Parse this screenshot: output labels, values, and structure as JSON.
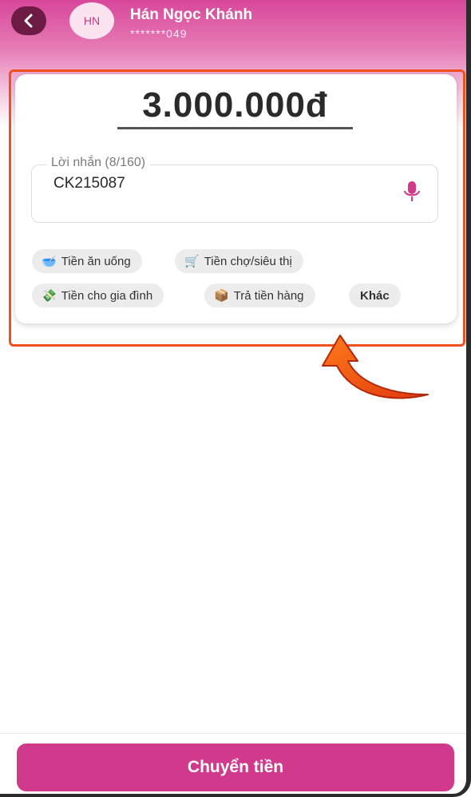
{
  "header": {
    "avatar_initials": "HN",
    "user_name": "Hán Ngọc Khánh",
    "user_phone": "*******049"
  },
  "amount": "3.000.000đ",
  "message": {
    "label": "Lời nhắn (8/160)",
    "value": "CK215087"
  },
  "chips": [
    {
      "label": "Tiền ăn uống",
      "icon": "food-bowl-icon"
    },
    {
      "label": "Tiền chợ/siêu thị",
      "icon": "shopping-cart-icon"
    },
    {
      "label": "Tiền cho gia đình",
      "icon": "money-icon"
    },
    {
      "label": "Trả tiền hàng",
      "icon": "package-icon"
    },
    {
      "label": "Khác"
    }
  ],
  "footer": {
    "transfer_label": "Chuyển tiền"
  },
  "colors": {
    "brand": "#d1398c",
    "highlight": "#f0501e"
  }
}
